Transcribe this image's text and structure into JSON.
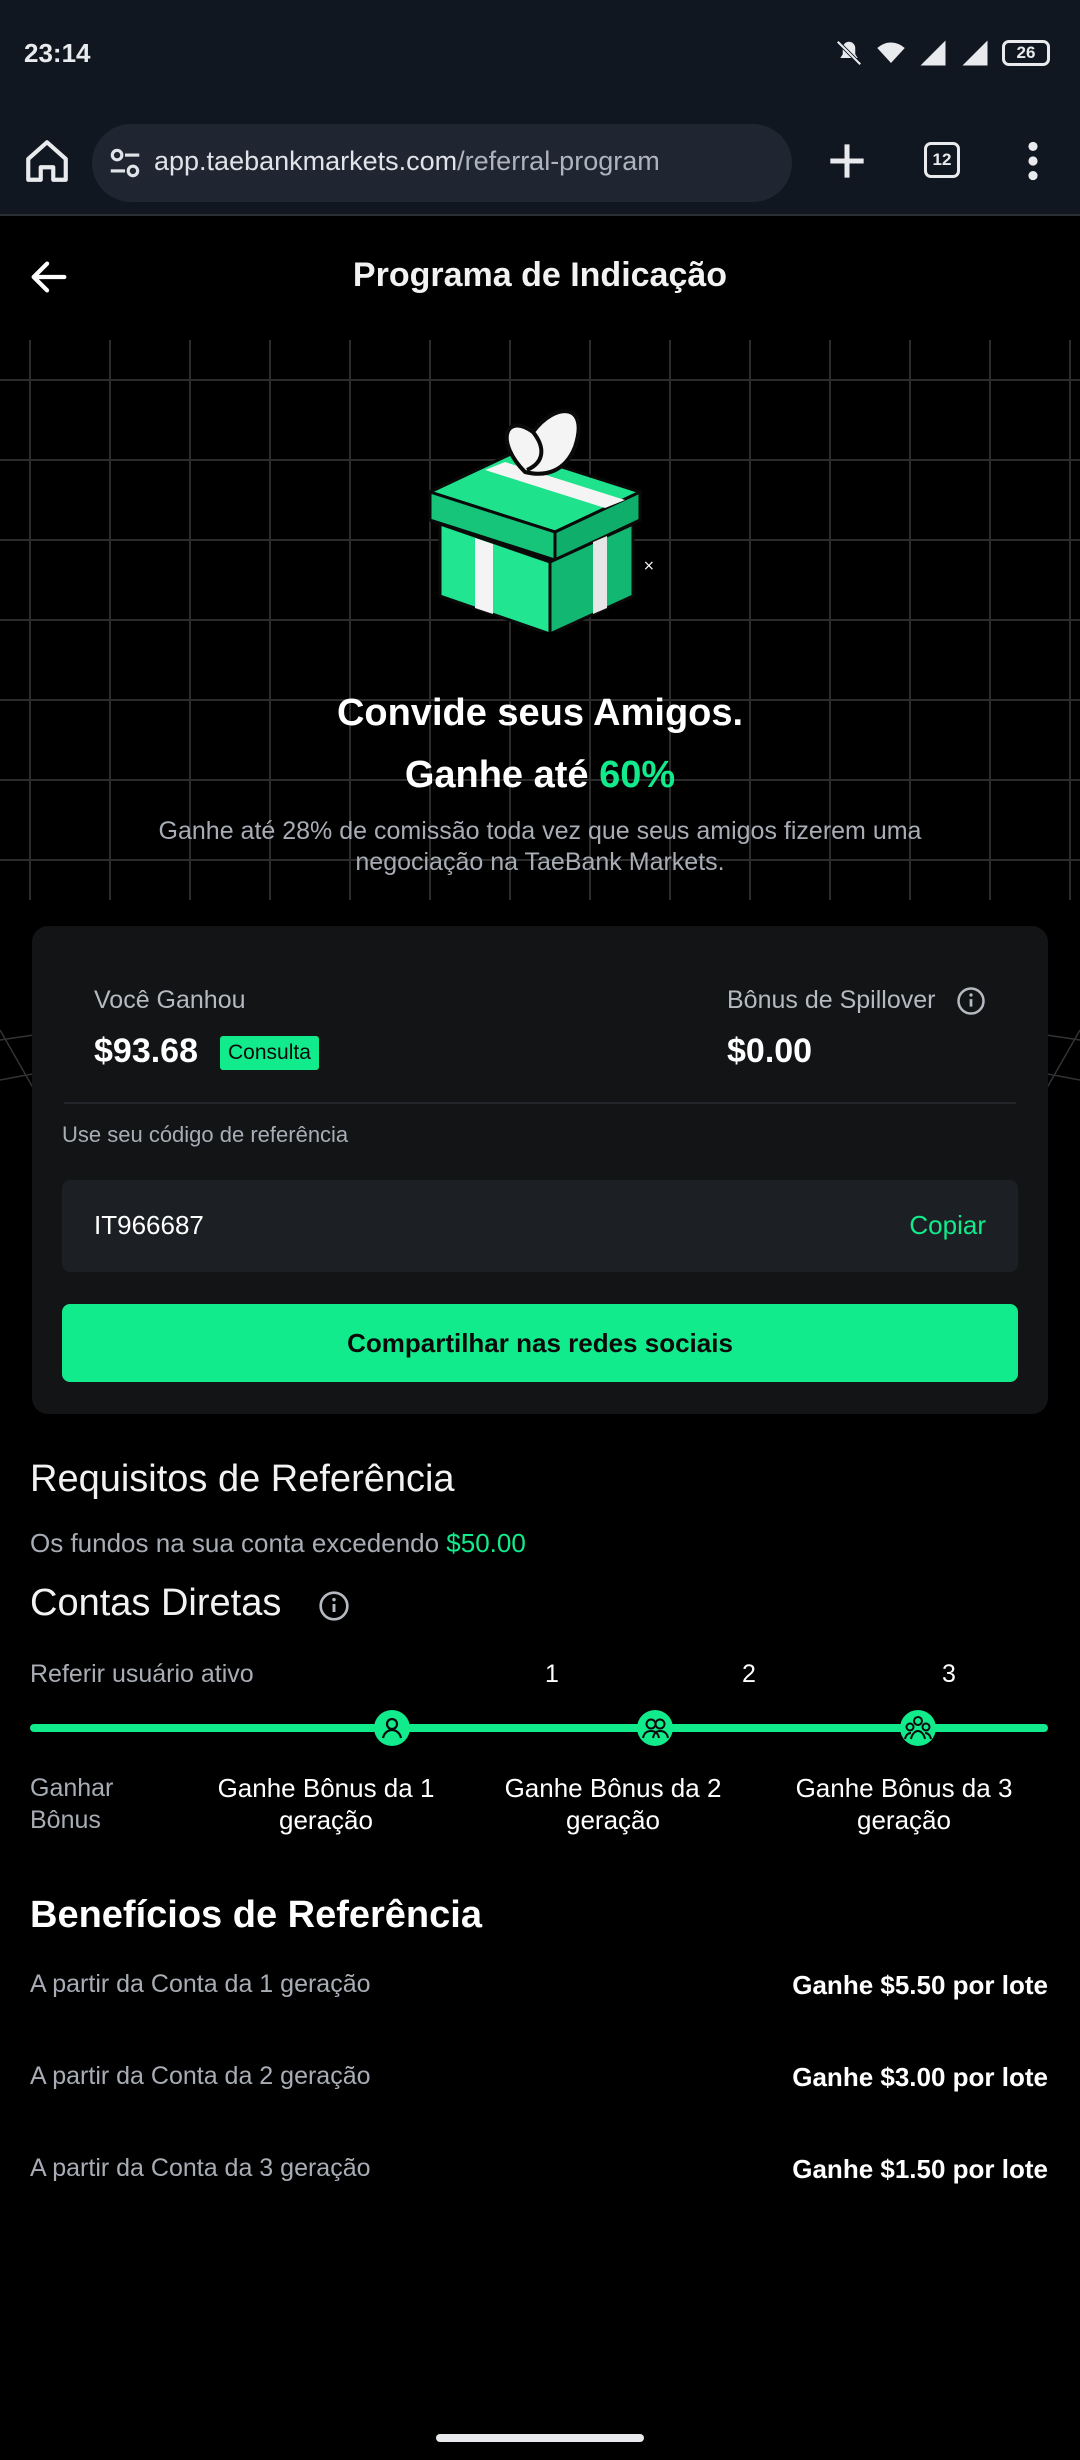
{
  "status_bar": {
    "time": "23:14",
    "battery": "26"
  },
  "browser": {
    "url_host": "app.taebankmarkets.com",
    "url_path": "/referral-program",
    "tab_count": "12"
  },
  "header": {
    "title": "Programa de Indicação"
  },
  "hero": {
    "title": "Convide seus Amigos.",
    "subtitle_prefix": "Ganhe até ",
    "subtitle_accent": "60%",
    "description": "Ganhe até 28% de comissão toda vez que seus amigos fizerem uma negociação na TaeBank Markets."
  },
  "card": {
    "earned_label": "Você Ganhou",
    "earned_value": "$93.68",
    "consult_badge": "Consulta",
    "spillover_label": "Bônus de Spillover",
    "spillover_value": "$0.00",
    "referral_code_label": "Use seu código de referência",
    "referral_code": "IT966687",
    "copy_label": "Copiar",
    "share_label": "Compartilhar nas redes sociais"
  },
  "requirements": {
    "title": "Requisitos de Referência",
    "text_prefix": "Os fundos na sua conta excedendo ",
    "text_amount": "$50.00"
  },
  "direct": {
    "title": "Contas Diretas",
    "refer_label": "Referir usuário ativo",
    "ticks": [
      "1",
      "2",
      "3"
    ],
    "gain_label": "Ganhar Bônus",
    "generations": [
      "Ganhe Bônus da 1 geração",
      "Ganhe Bônus da 2 geração",
      "Ganhe Bônus da 3 geração"
    ]
  },
  "benefits": {
    "title": "Benefícios de Referência",
    "rows": [
      {
        "label": "A partir da Conta da 1 geração",
        "value": "Ganhe $5.50 por lote"
      },
      {
        "label": "A partir da Conta da 2 geração",
        "value": "Ganhe $3.00 por lote"
      },
      {
        "label": "A partir da Conta da 3 geração",
        "value": "Ganhe $1.50 por lote"
      }
    ]
  },
  "colors": {
    "accent": "#12eb8b",
    "background": "#000000",
    "card": "#131416"
  }
}
